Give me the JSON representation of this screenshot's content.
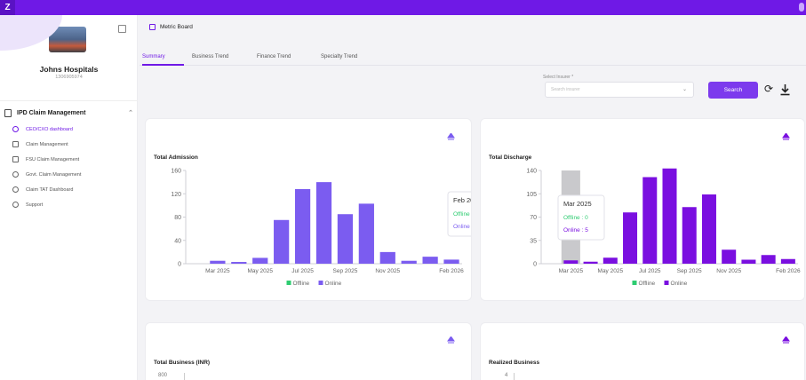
{
  "app": {
    "logo_letter": "Z",
    "accent": "#6f19e6",
    "button_color": "#7c3aed"
  },
  "sidebar": {
    "hospital_name": "Johns Hospitals",
    "hospital_id": "1306905974",
    "menu_section": "IPD Claim Management",
    "items": [
      {
        "label": "CEO/CXO dashboard",
        "icon": "clock-icon",
        "active": true
      },
      {
        "label": "Claim Management",
        "icon": "document-icon",
        "active": false
      },
      {
        "label": "FSU Claim Management",
        "icon": "building-icon",
        "active": false
      },
      {
        "label": "Govt. Claim Management",
        "icon": "gear-icon",
        "active": false
      },
      {
        "label": "Claim TAT Dashboard",
        "icon": "gear-icon",
        "active": false
      },
      {
        "label": "Support",
        "icon": "headset-icon",
        "active": false
      }
    ]
  },
  "header": {
    "breadcrumb": "Metric Board"
  },
  "tabs": [
    {
      "label": "Summary",
      "active": true
    },
    {
      "label": "Business Trend",
      "active": false
    },
    {
      "label": "Finance Trend",
      "active": false
    },
    {
      "label": "Specialty Trend",
      "active": false
    }
  ],
  "filters": {
    "insurer_label": "Select Insurer *",
    "insurer_placeholder": "Search insurer",
    "search_label": "Search"
  },
  "cards": {
    "admission_title": "Total Admission",
    "discharge_title": "Total Discharge",
    "business_title": "Total Business (INR)",
    "realized_title": "Realized Business",
    "business_first_tick": "800",
    "realized_first_tick": "4"
  },
  "chart_data": [
    {
      "type": "bar",
      "title": "Total Admission",
      "categories": [
        "Feb 2025",
        "Mar 2025",
        "Apr 2025",
        "May 2025",
        "Jun 2025",
        "Jul 2025",
        "Aug 2025",
        "Sep 2025",
        "Oct 2025",
        "Nov 2025",
        "Dec 2025",
        "Jan 2026",
        "Feb 2026"
      ],
      "tick_labels": [
        "Mar 2025",
        "May 2025",
        "Jul 2025",
        "Sep 2025",
        "Nov 2025",
        "Feb 2026"
      ],
      "series": [
        {
          "name": "Offline",
          "color": "#2ecc71",
          "values": [
            0,
            0,
            0,
            0,
            0,
            0,
            0,
            0,
            0,
            0,
            0,
            0,
            0
          ]
        },
        {
          "name": "Online",
          "color": "#7b5cf0",
          "values": [
            0,
            5,
            3,
            10,
            75,
            128,
            140,
            85,
            103,
            20,
            5,
            12,
            7
          ]
        }
      ],
      "yticks": [
        0,
        40,
        80,
        120,
        160
      ],
      "ylim": [
        0,
        160
      ],
      "legend": "bottom",
      "tooltip": {
        "title": "Feb 2026",
        "offline": "Offline : 0",
        "online": "Online : 7"
      }
    },
    {
      "type": "bar",
      "title": "Total Discharge",
      "categories": [
        "Feb 2025",
        "Mar 2025",
        "Apr 2025",
        "May 2025",
        "Jun 2025",
        "Jul 2025",
        "Aug 2025",
        "Sep 2025",
        "Oct 2025",
        "Nov 2025",
        "Dec 2025",
        "Jan 2026",
        "Feb 2026"
      ],
      "tick_labels": [
        "Mar 2025",
        "May 2025",
        "Jul 2025",
        "Sep 2025",
        "Nov 2025",
        "Feb 2026"
      ],
      "series": [
        {
          "name": "Offline",
          "color": "#2ecc71",
          "values": [
            0,
            0,
            0,
            0,
            0,
            0,
            0,
            0,
            0,
            0,
            0,
            0,
            0
          ]
        },
        {
          "name": "Online",
          "color": "#7a0fe0",
          "values": [
            0,
            5,
            3,
            9,
            77,
            130,
            143,
            85,
            104,
            21,
            6,
            13,
            7
          ]
        }
      ],
      "yticks": [
        "0",
        "35",
        "70",
        "105",
        "140"
      ],
      "ylim": [
        0,
        140
      ],
      "legend": "bottom",
      "highlight_index": 1,
      "tooltip": {
        "title": "Mar 2025",
        "offline": "Offline : 0",
        "online": "Online : 5"
      }
    }
  ]
}
